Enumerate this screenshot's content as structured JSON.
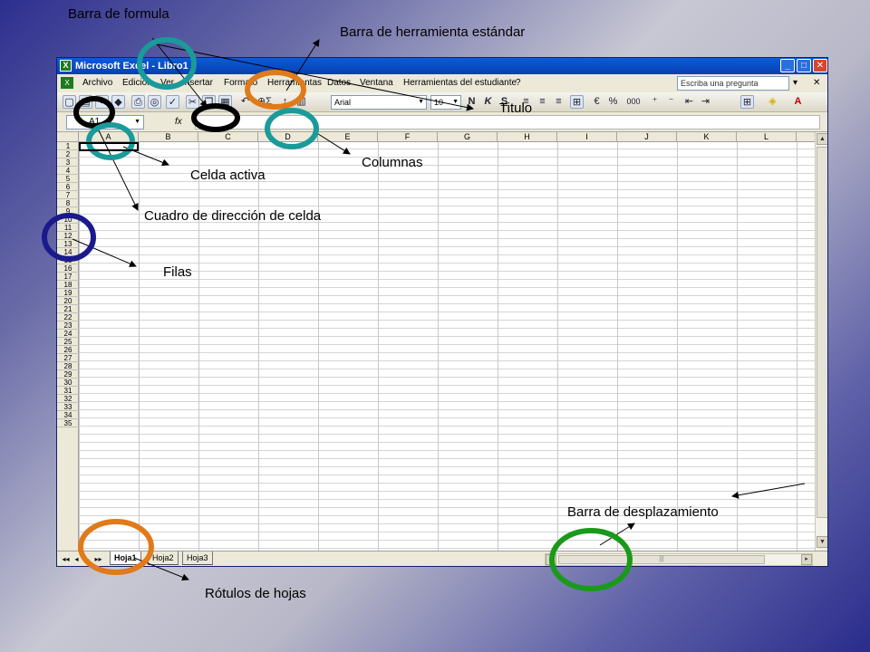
{
  "window": {
    "title": "Microsoft Excel - Libro1",
    "minimize_symbol": "_",
    "maximize_symbol": "□",
    "close_symbol": "✕"
  },
  "menu": {
    "items": [
      "Archivo",
      "Edición",
      "Ver",
      "Insertar",
      "Formato",
      "Herramientas",
      "Datos",
      "Ventana",
      "Herramientas del estudiante",
      "?"
    ],
    "ask_placeholder": "Escriba una pregunta",
    "dropdown_symbol": "▾",
    "close_symbol": "✕"
  },
  "toolbar": {
    "font_name": "Arial",
    "font_size": "10",
    "bold": "N",
    "italic": "K",
    "underline": "S",
    "autosum": "Σ",
    "euro": "€",
    "percent": "%",
    "thousands": "000"
  },
  "formula_bar": {
    "name_box": "A1",
    "fx": "fx",
    "value": ""
  },
  "grid": {
    "columns": [
      "A",
      "B",
      "C",
      "D",
      "E",
      "F",
      "G",
      "H",
      "I",
      "J",
      "K",
      "L"
    ],
    "rows": [
      "1",
      "2",
      "3",
      "4",
      "5",
      "6",
      "7",
      "8",
      "9",
      "10",
      "11",
      "12",
      "13",
      "14",
      "15",
      "16",
      "17",
      "18",
      "19",
      "20",
      "21",
      "22",
      "23",
      "24",
      "25",
      "26",
      "27",
      "28",
      "29",
      "30",
      "31",
      "32",
      "33",
      "34",
      "35"
    ]
  },
  "sheets": {
    "tabs": [
      "Hoja1",
      "Hoja2",
      "Hoja3"
    ],
    "active": "Hoja1",
    "nav": [
      "◂◂",
      "◂",
      "▸",
      "▸▸"
    ]
  },
  "annotations": {
    "barra_formula": "Barra de formula",
    "barra_herramienta": "Barra de herramienta estándar",
    "titulo": "Titulo",
    "celda_activa": "Celda activa",
    "columnas": "Columnas",
    "cuadro_direccion": "Cuadro de dirección de celda",
    "filas": "Filas",
    "barra_desplazamiento": "Barra de desplazamiento",
    "rotulos_hojas": "Rótulos de hojas"
  },
  "colors": {
    "circle_teal": "#1a9a9a",
    "circle_orange": "#e07a1a",
    "circle_black": "#000000",
    "circle_blue": "#1a1a8c",
    "circle_green": "#1a9a1a",
    "titlebar": "#0a4fc8"
  }
}
